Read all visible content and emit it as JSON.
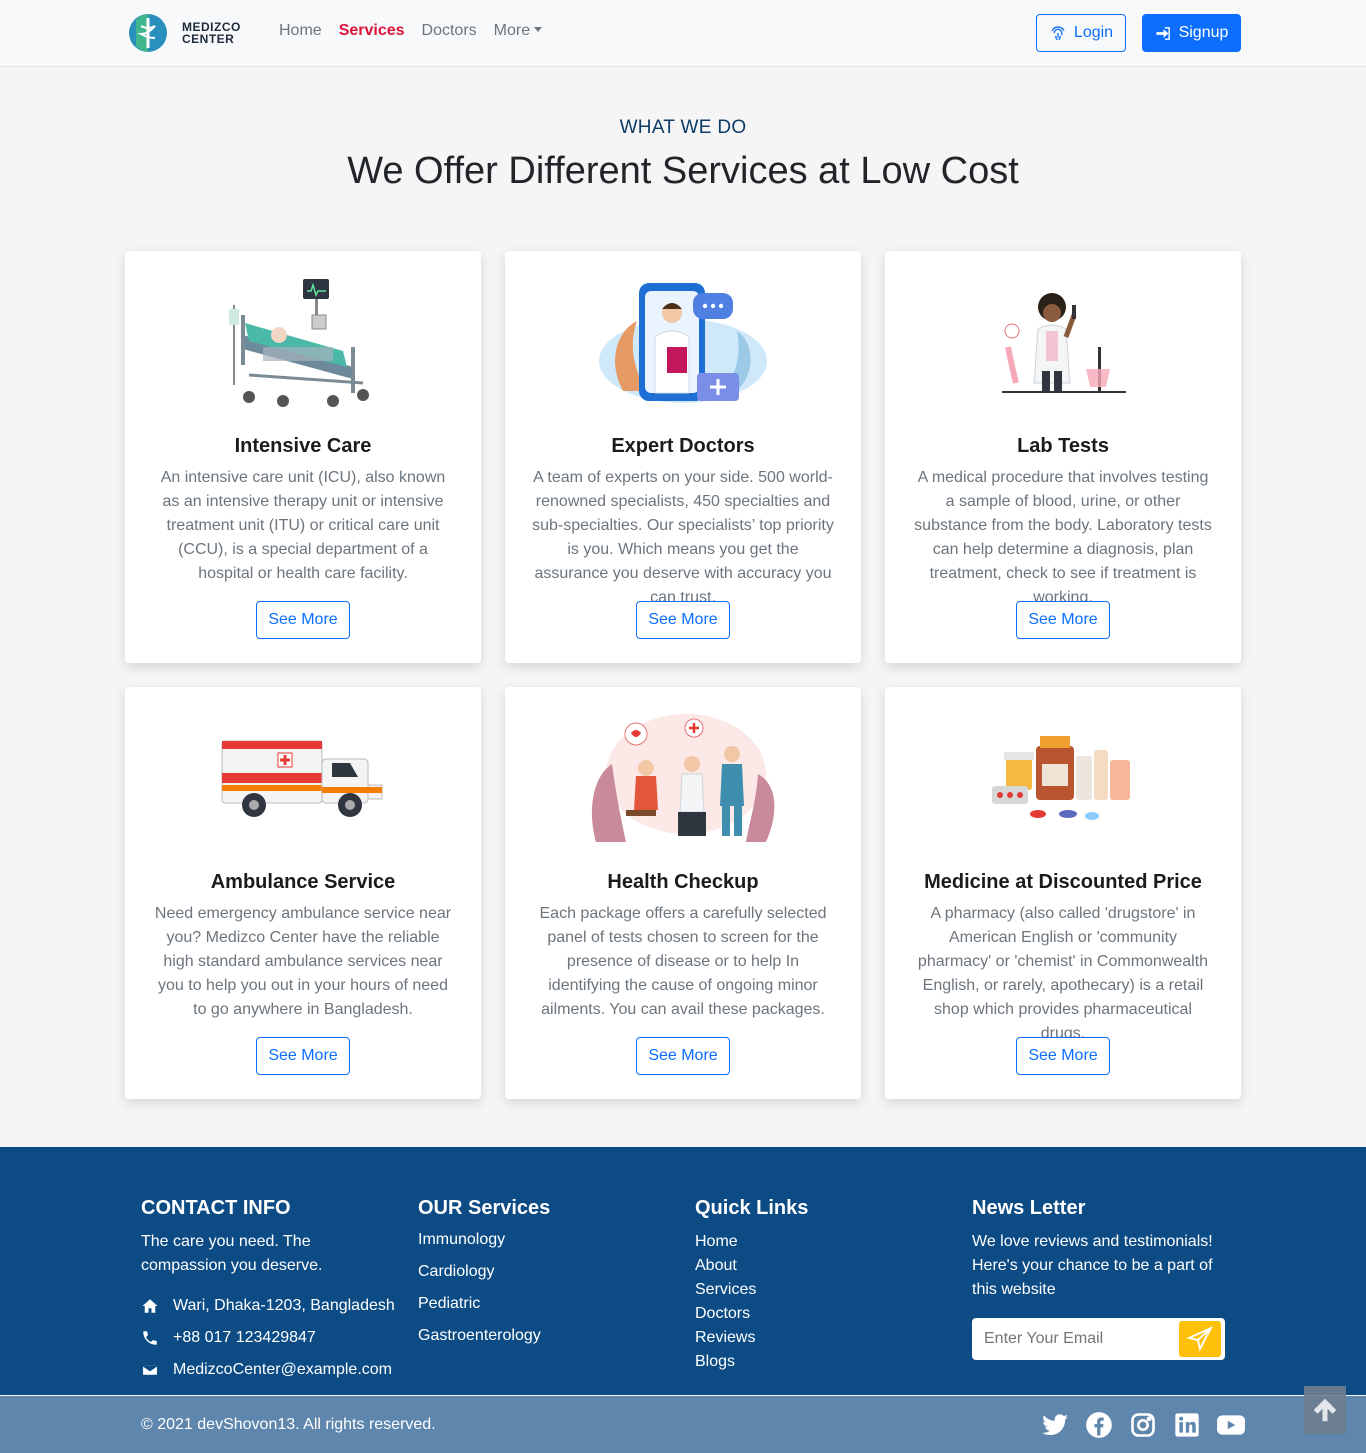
{
  "nav": {
    "brand_line1": "MEDIZCO",
    "brand_line2": "CENTER",
    "links": [
      "Home",
      "Services",
      "Doctors",
      "More"
    ],
    "active": "Services",
    "login": "Login",
    "signup": "Signup"
  },
  "hero": {
    "eyebrow": "WHAT WE DO",
    "title": "We Offer Different Services at Low Cost"
  },
  "services": [
    {
      "title": "Intensive Care",
      "text": "An intensive care unit (ICU), also known as an intensive therapy unit or intensive treatment unit (ITU) or critical care unit (CCU), is a special department of a hospital or health care facility.",
      "button": "See More",
      "image": "hospital-bed-illustration"
    },
    {
      "title": "Expert Doctors",
      "text": "A team of experts on your side. 500 world-renowned specialists, 450 specialties and sub-specialties. Our specialists’ top priority is you. Which means you get the assurance you deserve with accuracy you can trust.",
      "button": "See More",
      "image": "doctor-phone-illustration"
    },
    {
      "title": "Lab Tests",
      "text": "A medical procedure that involves testing a sample of blood, urine, or other substance from the body. Laboratory tests can help determine a diagnosis, plan treatment, check to see if treatment is working.",
      "button": "See More",
      "image": "lab-scientist-illustration"
    },
    {
      "title": "Ambulance Service",
      "text": "Need emergency ambulance service near you? Medizco Center have the reliable high standard ambulance services near you to help you out in your hours of need to go anywhere in Bangladesh.",
      "button": "See More",
      "image": "ambulance-illustration"
    },
    {
      "title": "Health Checkup",
      "text": "Each package offers a carefully selected panel of tests chosen to screen for the presence of disease or to help In identifying the cause of ongoing minor ailments. You can avail these packages.",
      "button": "See More",
      "image": "health-checkup-illustration"
    },
    {
      "title": "Medicine at Discounted Price",
      "text": "A pharmacy (also called 'drugstore' in American English or 'community pharmacy' or 'chemist' in Commonwealth English, or rarely, apothecary) is a retail shop which provides pharmaceutical drugs.",
      "button": "See More",
      "image": "medicine-illustration"
    }
  ],
  "footer": {
    "contact": {
      "heading": "CONTACT INFO",
      "tagline": "The care you need. The compassion you deserve.",
      "address": "Wari, Dhaka-1203, Bangladesh",
      "phone": "+88 017 123429847",
      "email": "MedizcoCenter@example.com"
    },
    "services": {
      "heading": "OUR Services",
      "items": [
        "Immunology",
        "Cardiology",
        "Pediatric",
        "Gastroenterology"
      ]
    },
    "quick_links": {
      "heading": "Quick Links",
      "items": [
        "Home",
        "About",
        "Services",
        "Doctors",
        "Reviews",
        "Blogs"
      ]
    },
    "newsletter": {
      "heading": "News Letter",
      "text": "We love reviews and testimonials! Here's your chance to be a part of this website",
      "placeholder": "Enter Your Email"
    },
    "copyright": "© 2021 devShovon13. All rights reserved.",
    "socials": [
      "twitter-icon",
      "facebook-icon",
      "instagram-icon",
      "linkedin-icon",
      "youtube-icon"
    ]
  },
  "colors": {
    "primary": "#0d6efd",
    "active_nav": "#dc143c",
    "footer_bg": "#0d4b84",
    "bottom_bar": "#5f86ad",
    "send_button": "#ffc107"
  }
}
